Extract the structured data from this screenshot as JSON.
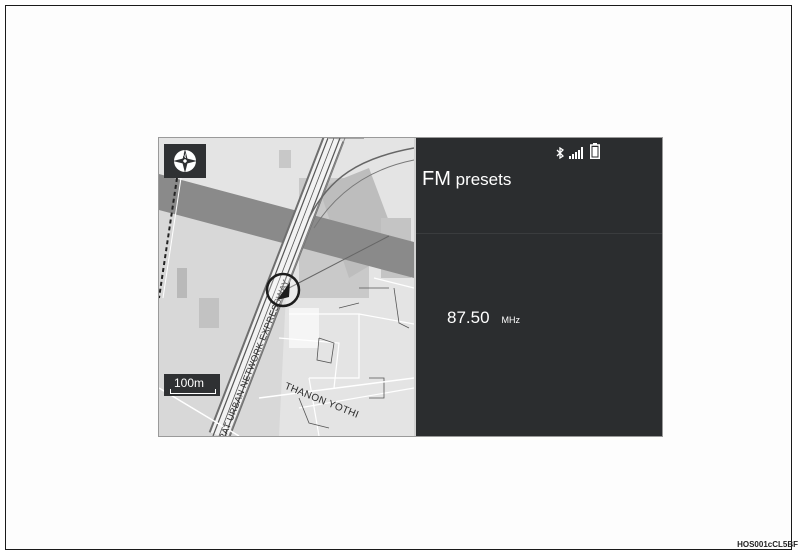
{
  "map": {
    "scale_label": "100m",
    "road_labels": {
      "expressway": "RAT URBAN NETWORK EXPRESSWAY",
      "street": "THANON YOTHI"
    },
    "icons": {
      "compass": "north-up-compass-icon",
      "position": "vehicle-position-marker-icon"
    }
  },
  "radio": {
    "title_main": "FM",
    "title_rest": " presets",
    "frequency": "87.50",
    "unit": "MHz"
  },
  "status_bar": {
    "icons": [
      "bluetooth-icon",
      "signal-strength-icon",
      "battery-icon"
    ]
  },
  "figure_code": "HOS001cCL5BF",
  "colors": {
    "screen_bg": "#2b2d2f",
    "map_bg": "#e6e6e6",
    "text": "#ffffff"
  }
}
